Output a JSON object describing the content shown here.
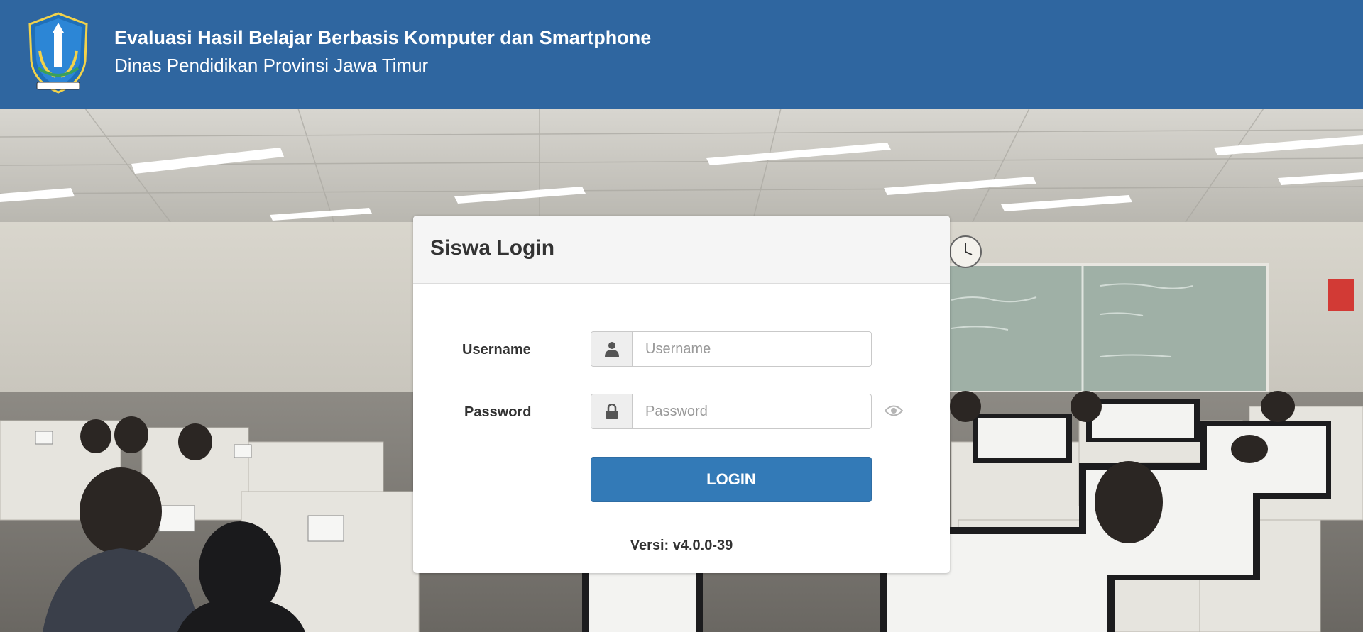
{
  "header": {
    "title": "Evaluasi Hasil Belajar Berbasis Komputer dan Smartphone",
    "subtitle": "Dinas Pendidikan Provinsi Jawa Timur",
    "logo_icon": "east-java-emblem-icon",
    "background_color": "#2f66a0"
  },
  "login": {
    "title": "Siswa Login",
    "username_label": "Username",
    "username_placeholder": "Username",
    "username_value": "",
    "username_icon": "user-icon",
    "password_label": "Password",
    "password_placeholder": "Password",
    "password_value": "",
    "password_icon": "lock-icon",
    "show_password_icon": "eye-icon",
    "button_label": "LOGIN",
    "button_color": "#337ab7",
    "version": "Versi: v4.0.0-39"
  }
}
